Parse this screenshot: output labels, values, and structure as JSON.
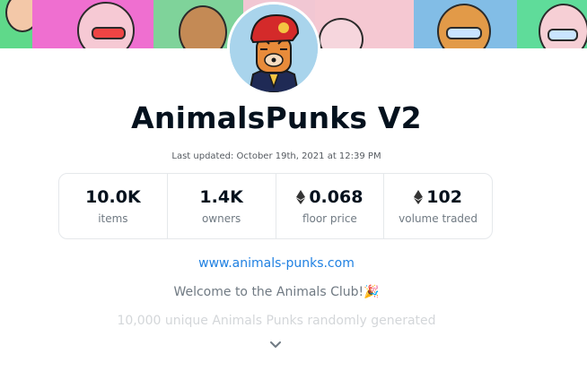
{
  "collection": {
    "title": "AnimalsPunks V2",
    "last_updated": "Last updated: October 19th, 2021 at 12:39 PM",
    "website": "www.animals-punks.com",
    "description_line1": "Welcome to the Animals Club!🎉",
    "description_line2": "10,000 unique Animals Punks randomly generated"
  },
  "stats": [
    {
      "value": "10.0K",
      "label": "items",
      "eth": false
    },
    {
      "value": "1.4K",
      "label": "owners",
      "eth": false
    },
    {
      "value": "0.068",
      "label": "floor price",
      "eth": true
    },
    {
      "value": "102",
      "label": "volume traded",
      "eth": true
    }
  ],
  "icons": {
    "eth": "ethereum-icon",
    "expand": "chevron-down-icon"
  },
  "colors": {
    "link": "#2081e2",
    "text_primary": "#04111d",
    "text_secondary": "#707a83",
    "border": "#e5e8eb"
  }
}
